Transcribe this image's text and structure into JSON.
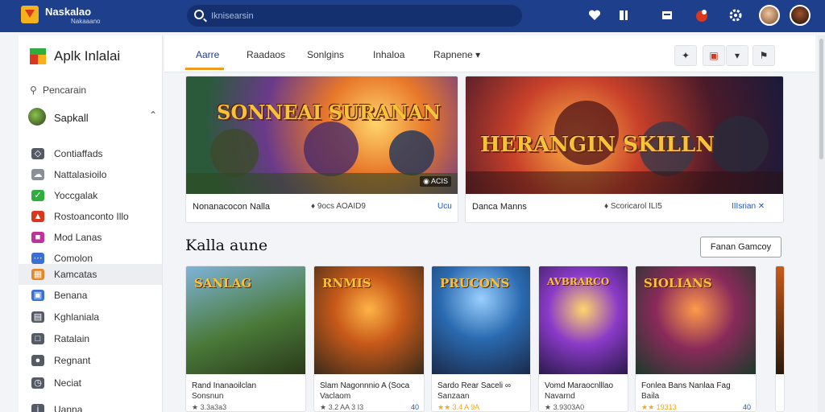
{
  "header": {
    "brand": "Naskalao",
    "brand_sub": "Nakaaano",
    "search_placeholder": "Iknisearsin",
    "icons": [
      "heart-icon",
      "bookmark-icon",
      "store-icon",
      "notification-icon",
      "gear-icon",
      "avatar",
      "avatar"
    ]
  },
  "sidebar": {
    "title": "Aplk Inlalai",
    "search_label": "Pencarain",
    "user_label": "Sapkall",
    "items": [
      {
        "label": "Contiaffads",
        "icon": "controller-icon",
        "color": "#555b66"
      },
      {
        "label": "Nattalasioilo",
        "icon": "cloud-icon",
        "color": "#8a9099"
      },
      {
        "label": "Yoccgalak",
        "icon": "check-icon",
        "color": "#2fae3e"
      },
      {
        "label": "Rostoanconto Illo",
        "icon": "fire-icon",
        "color": "#d9381e"
      },
      {
        "label": "Mod Lanas",
        "icon": "mod-icon",
        "color": "#c0329b"
      },
      {
        "label": "Comolon",
        "icon": "dots-icon",
        "color": "#3b6fd1"
      },
      {
        "label": "Kamcatas",
        "icon": "grid-icon",
        "color": "#e4862a"
      },
      {
        "label": "Benana",
        "icon": "image-icon",
        "color": "#3b6fd1"
      },
      {
        "label": "Kghlaniala",
        "icon": "calendar-icon",
        "color": "#555b66"
      },
      {
        "label": "Ratalain",
        "icon": "box-icon",
        "color": "#555b66"
      },
      {
        "label": "Regnant",
        "icon": "lock-icon",
        "color": "#555b66"
      },
      {
        "label": "Neciat",
        "icon": "clock-icon",
        "color": "#555b66"
      },
      {
        "label": "Uanna",
        "icon": "info-icon",
        "color": "#555b66"
      }
    ]
  },
  "tabs": [
    "Aarre",
    "Raadaos",
    "Sonlgins",
    "Inhaloa",
    "Rapnene"
  ],
  "features": [
    {
      "title": "SONNEAI SURANAN",
      "caption": "Nonanacocon Nalla",
      "meta": "♦ 9ocs AOAID9",
      "tag": "Ucu",
      "badge": "◉ ACIS"
    },
    {
      "title": "HERANGIN SKILLN",
      "caption": "Danca Manns",
      "meta": "♦ Scoricarol ILI5",
      "tag": "IIIsrian ✕",
      "badge": ""
    }
  ],
  "section": {
    "title": "Kalla aune",
    "button": "Fanan Gamcoy"
  },
  "cards": [
    {
      "art_title": "SANLAG",
      "title": "Rand Inanaoilclan",
      "sub": "Sonsnun",
      "rating": "★ 3.3a3a3",
      "price": ""
    },
    {
      "art_title": "RNMIS",
      "title": "Slam Nagonnnio A (Soca",
      "sub": "Vaclaom",
      "rating": "★ 3.2 AA 3 I3",
      "price": "40"
    },
    {
      "art_title": "PRUCONS",
      "title": "Sardo Rear Saceli ∞",
      "sub": "Sanzaan",
      "rating": "★★ 3.4 A 9A",
      "price": ""
    },
    {
      "art_title": "AVBRARCO",
      "title": "Vomd Maraocnlllao",
      "sub": "Navarnd",
      "rating": "★ 3.9303A0",
      "price": ""
    },
    {
      "art_title": "SIOLIANS",
      "title": "Fonlea Bans Nanlaa Fag",
      "sub": "Baila",
      "rating": "★★ 19313",
      "price": "40"
    }
  ]
}
